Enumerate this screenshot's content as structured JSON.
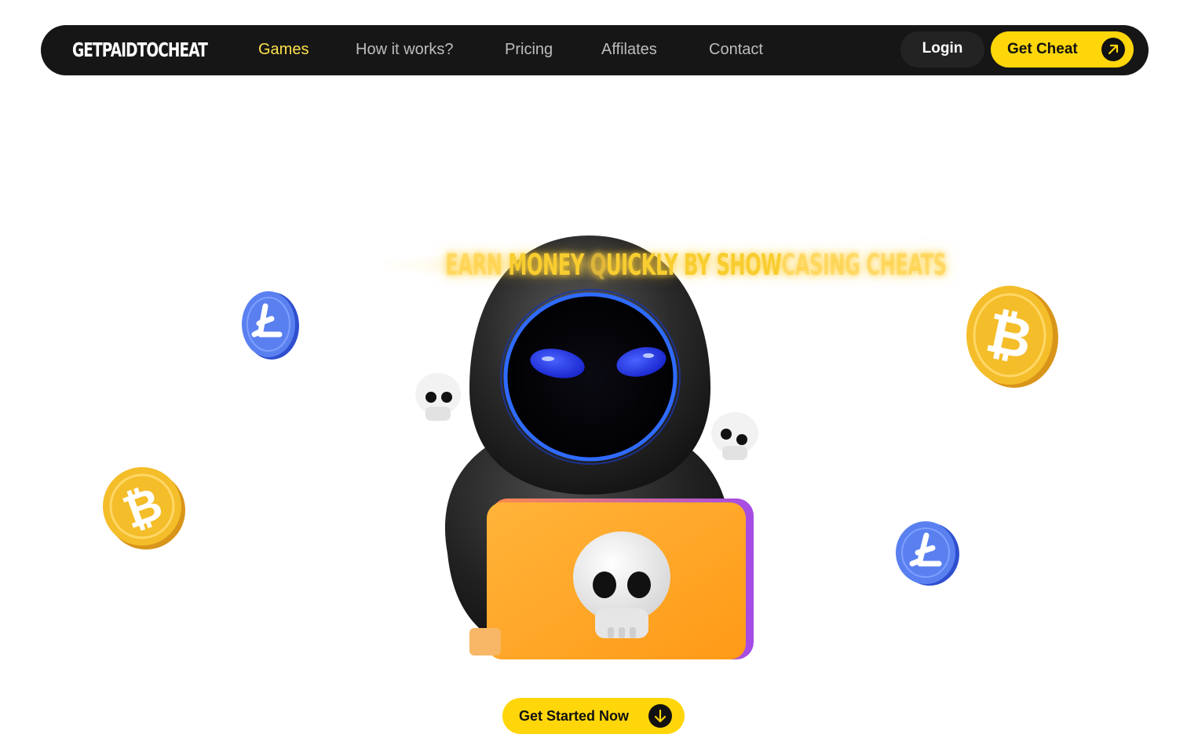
{
  "brand": {
    "logo_text": "GETPAIDTOCHEAT"
  },
  "nav": {
    "links": [
      {
        "label": "Games",
        "active": true
      },
      {
        "label": "How it works?",
        "active": false
      },
      {
        "label": "Pricing",
        "active": false
      },
      {
        "label": "Affilates",
        "active": false
      },
      {
        "label": "Contact",
        "active": false
      }
    ],
    "login_label": "Login",
    "cta_label": "Get Cheat",
    "cta_icon": "arrow-up-right-icon"
  },
  "hero": {
    "title": {
      "part1": "EARN ",
      "part2": "MONEY ",
      "part3": "QUICKLY BY SHOW",
      "part4": "CASING CHEATS"
    },
    "illustration": "hooded-hacker-with-laptop-and-skulls",
    "cta_label": "Get Started Now",
    "cta_icon": "arrow-down-icon"
  },
  "decorations": {
    "coins": [
      "litecoin",
      "bitcoin",
      "bitcoin",
      "litecoin"
    ]
  },
  "colors": {
    "nav_bg": "#161616",
    "accent_yellow": "#ffd60a",
    "active_link": "#ffe14d",
    "litecoin_blue": "#4f77ea",
    "bitcoin_gold": "#f4b81f",
    "laptop_orange": "#ffa51f"
  }
}
